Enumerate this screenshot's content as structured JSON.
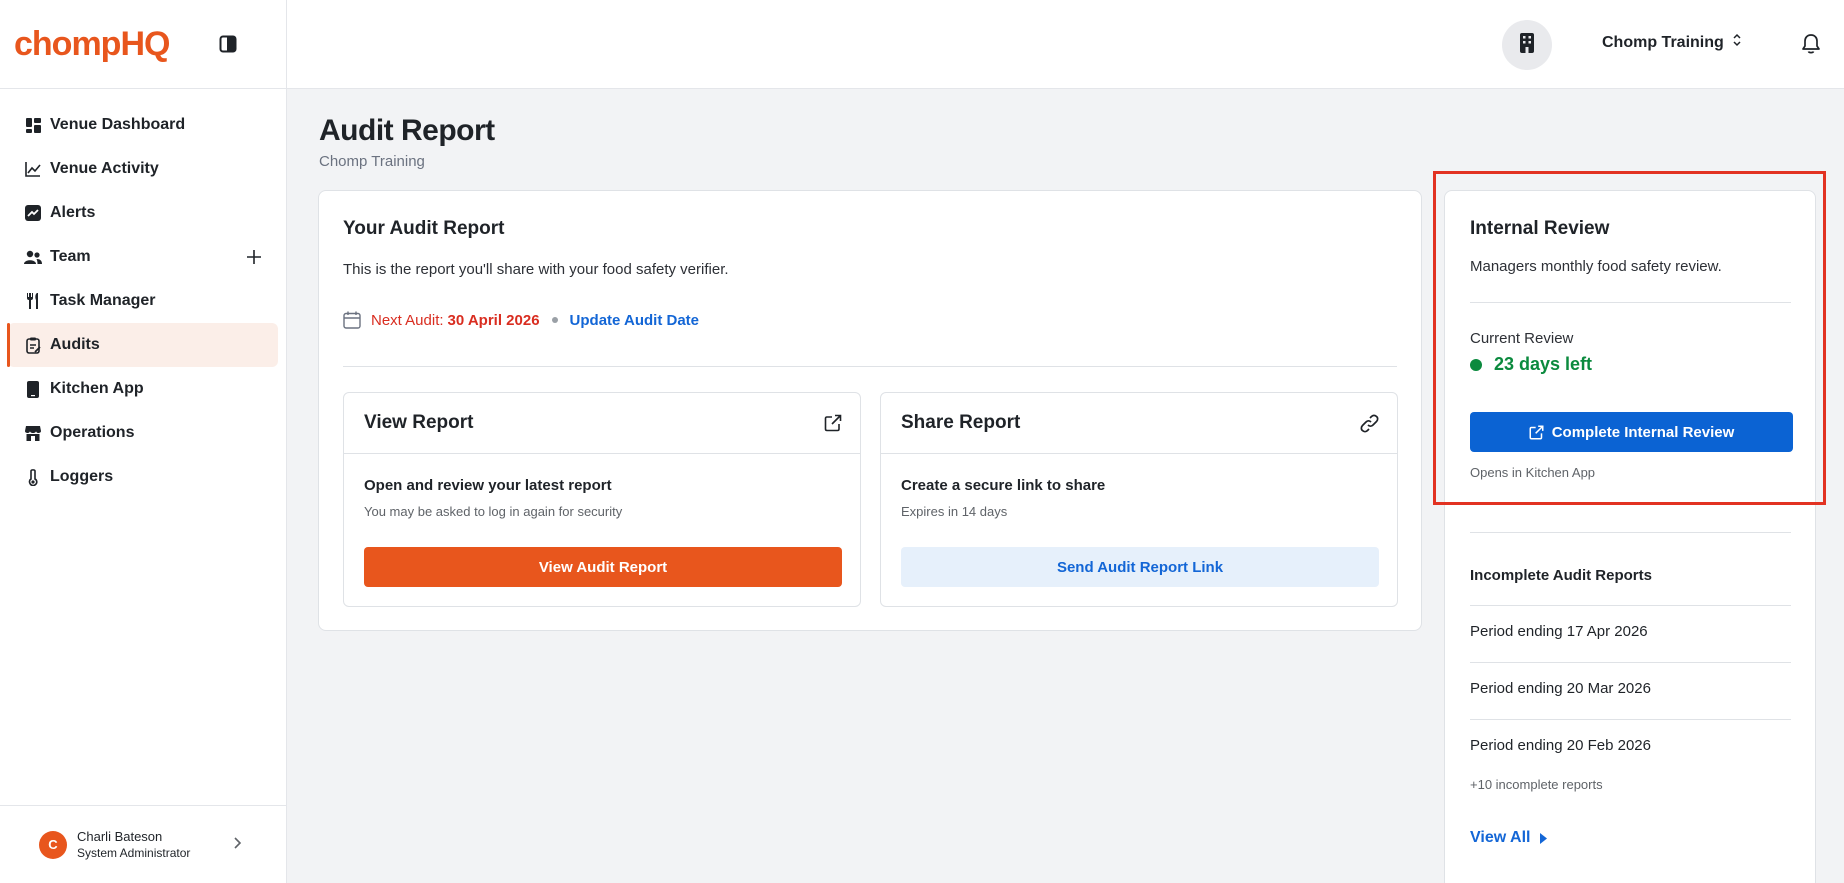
{
  "brand": {
    "logo": "chompHQ"
  },
  "sidebar": {
    "items": [
      {
        "label": "Venue Dashboard",
        "icon": "dashboard-icon"
      },
      {
        "label": "Venue Activity",
        "icon": "chart-line-icon"
      },
      {
        "label": "Alerts",
        "icon": "trend-icon"
      },
      {
        "label": "Team",
        "icon": "users-icon"
      },
      {
        "label": "Task Manager",
        "icon": "utensils-icon"
      },
      {
        "label": "Audits",
        "icon": "clipboard-icon",
        "active": true
      },
      {
        "label": "Kitchen App",
        "icon": "phone-icon"
      },
      {
        "label": "Operations",
        "icon": "store-icon"
      },
      {
        "label": "Loggers",
        "icon": "thermometer-icon"
      }
    ]
  },
  "user": {
    "initial": "C",
    "name": "Charli Bateson",
    "role": "System Administrator"
  },
  "topbar": {
    "venue": "Chomp Training"
  },
  "page": {
    "title": "Audit Report",
    "subtitle": "Chomp Training"
  },
  "audit_card": {
    "title": "Your Audit Report",
    "description": "This is the report you'll share with your food safety verifier.",
    "next_label": "Next Audit:",
    "next_date": "30 April 2026",
    "update_link": "Update Audit Date",
    "view": {
      "title": "View Report",
      "heading": "Open and review your latest report",
      "note": "You may be asked to log in again for security",
      "button": "View Audit Report"
    },
    "share": {
      "title": "Share Report",
      "heading": "Create a secure link to share",
      "note": "Expires in 14 days",
      "button": "Send Audit Report Link"
    }
  },
  "internal_review": {
    "title": "Internal Review",
    "description": "Managers monthly food safety review.",
    "current_label": "Current Review",
    "days_left": "23 days left",
    "button": "Complete Internal Review",
    "note": "Opens in Kitchen App",
    "incomplete_title": "Incomplete Audit Reports",
    "periods": [
      "Period ending 17 Apr 2026",
      "Period ending 20 Mar 2026",
      "Period ending 20 Feb 2026"
    ],
    "more": "+10 incomplete reports",
    "view_all": "View All"
  },
  "colors": {
    "brand_orange": "#e8561d",
    "link_blue": "#1366d6",
    "primary_blue": "#0b63d3",
    "success_green": "#0b8a3e",
    "danger_red": "#d92d20",
    "highlight_red": "#e23222"
  }
}
